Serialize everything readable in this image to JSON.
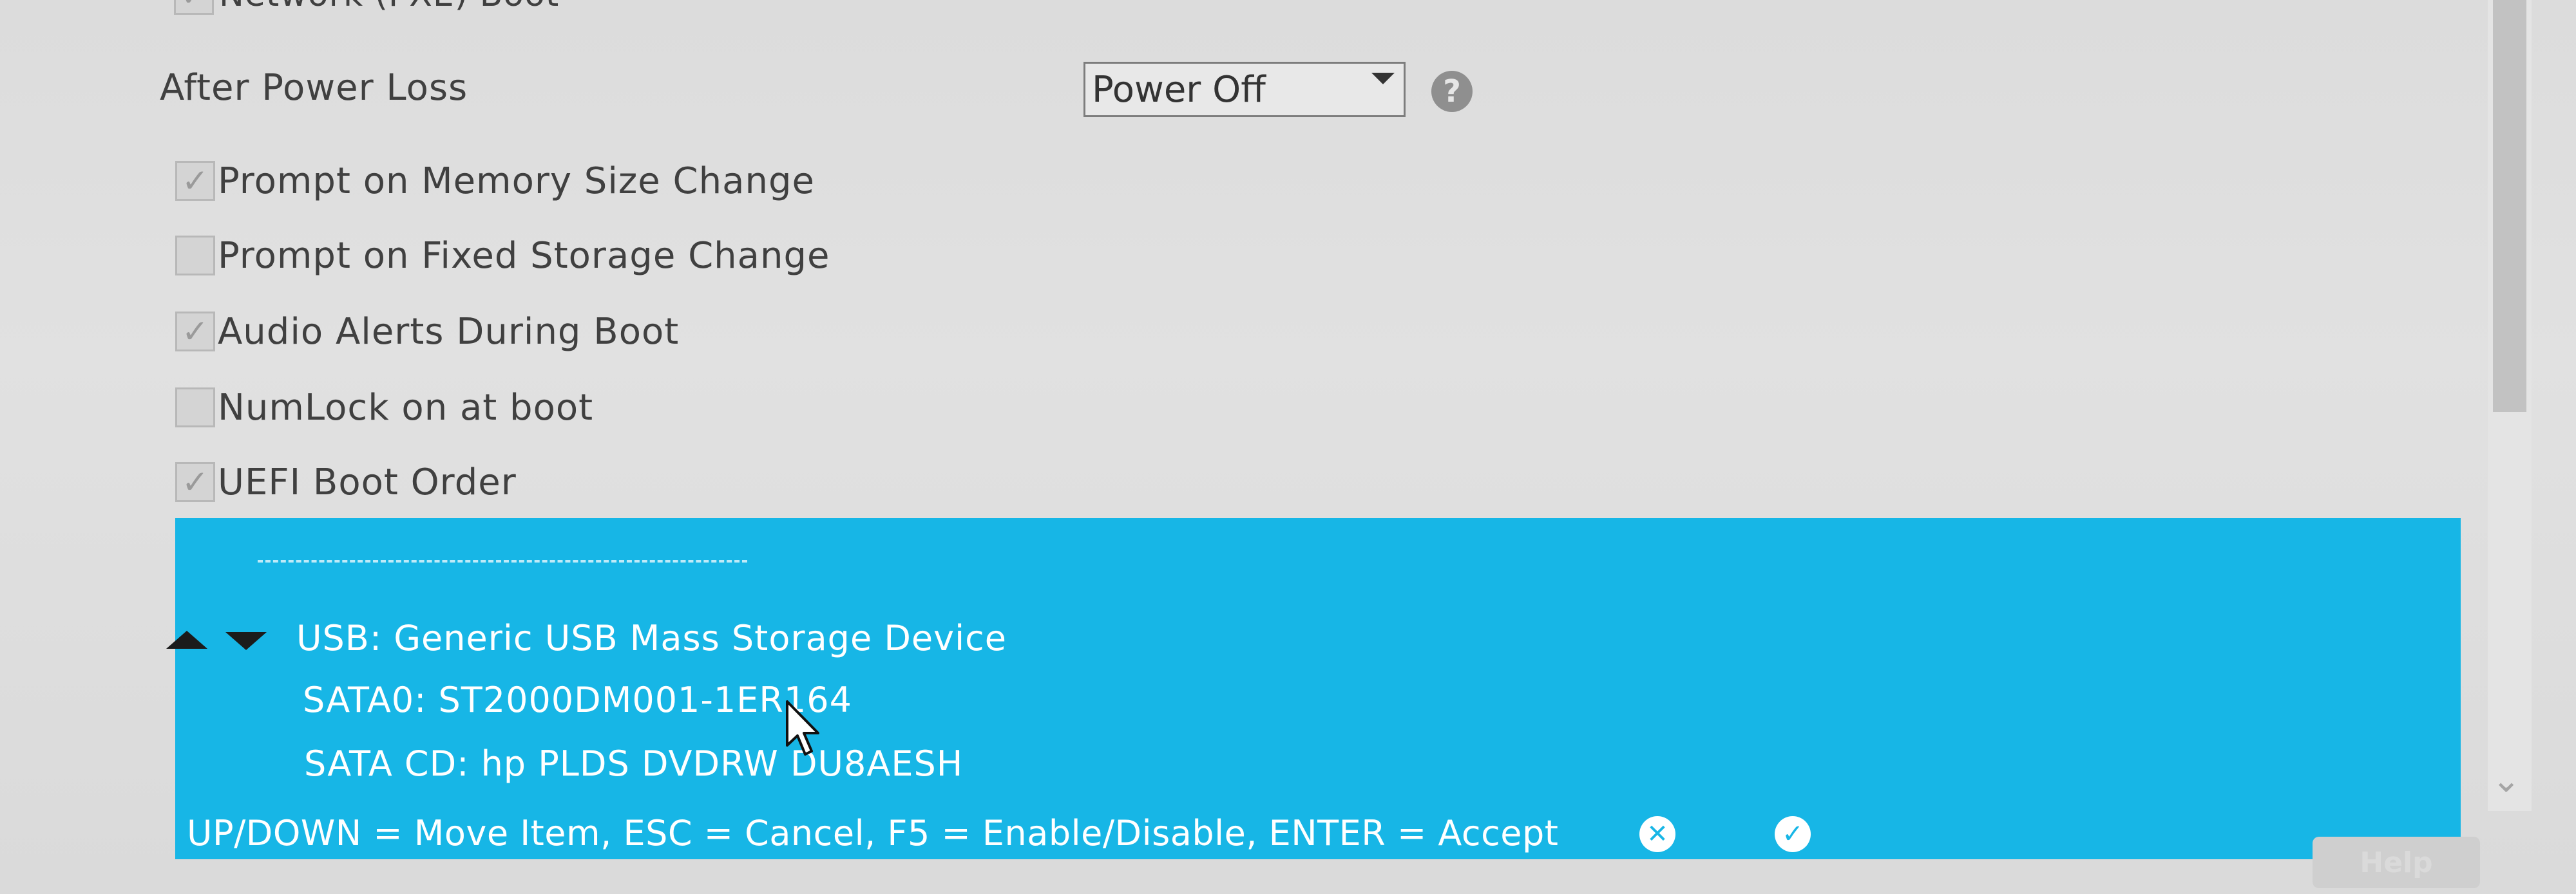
{
  "options": {
    "network_boot_label": "Network (PXE) Boot",
    "after_power_loss": {
      "label": "After Power Loss",
      "value": "Power Off"
    },
    "checkboxes": [
      {
        "label": "Prompt on Memory Size Change",
        "checked": true
      },
      {
        "label": "Prompt on Fixed Storage Change",
        "checked": false
      },
      {
        "label": "Audio Alerts During Boot",
        "checked": true
      },
      {
        "label": "NumLock on at boot",
        "checked": false
      },
      {
        "label": "UEFI Boot Order",
        "checked": true
      }
    ]
  },
  "boot_order": {
    "devices": [
      "USB:  Generic USB Mass Storage Device",
      "SATA0:  ST2000DM001-1ER164",
      "SATA CD:  hp PLDS DVDRW DU8AESH"
    ],
    "instructions": "UP/DOWN = Move Item,  ESC = Cancel,  F5 = Enable/Disable, ENTER = Accept"
  },
  "footer": {
    "button_label": "Help"
  },
  "icons": {
    "help": "question-icon",
    "cancel": "close-icon",
    "accept": "check-icon",
    "move_up": "triangle-up-icon",
    "move_down": "triangle-down-icon"
  },
  "colors": {
    "panel_accent": "#17b6e6",
    "background": "#dcdcdc"
  }
}
